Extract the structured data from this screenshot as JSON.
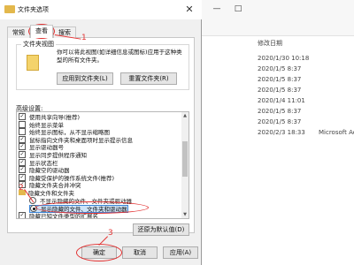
{
  "dialog": {
    "title": "文件夹选项",
    "close_glyph": "✕",
    "tabs": [
      "常规",
      "查看",
      "搜索"
    ],
    "folder_view": {
      "legend": "文件夹视图",
      "description": "你可以将此视图(如详细信息或图标)应用于这种类型的所有文件夹。",
      "apply_button": "应用到文件夹(L)",
      "reset_button": "重置文件夹(R)"
    },
    "advanced": {
      "label": "高级设置:",
      "items": [
        {
          "type": "checkbox",
          "checked": true,
          "label": "使用共享向导(推荐)"
        },
        {
          "type": "checkbox",
          "checked": false,
          "label": "始终显示菜单"
        },
        {
          "type": "checkbox",
          "checked": false,
          "label": "始终显示图标，从不显示缩略图"
        },
        {
          "type": "checkbox",
          "checked": true,
          "label": "鼠标指向文件夹和桌面项时显示提示信息"
        },
        {
          "type": "checkbox",
          "checked": true,
          "label": "显示驱动器号"
        },
        {
          "type": "checkbox",
          "checked": true,
          "label": "显示同步提供程序通知"
        },
        {
          "type": "checkbox",
          "checked": true,
          "label": "显示状态栏"
        },
        {
          "type": "checkbox",
          "checked": true,
          "label": "隐藏空的驱动器"
        },
        {
          "type": "checkbox",
          "checked": true,
          "label": "隐藏受保护的操作系统文件(推荐)"
        },
        {
          "type": "checkbox",
          "checked": true,
          "label": "隐藏文件夹合并冲突"
        },
        {
          "type": "folder",
          "label": "隐藏文件和文件夹"
        },
        {
          "type": "radio",
          "checked": false,
          "label": "不显示隐藏的文件、文件夹或驱动器"
        },
        {
          "type": "radio",
          "checked": true,
          "label": "显示隐藏的文件、文件夹和驱动器"
        },
        {
          "type": "checkbox",
          "checked": true,
          "label": "隐藏已知文件类型的扩展名"
        }
      ]
    },
    "restore_button": "还原为默认值(D)",
    "ok_button": "确定",
    "cancel_button": "取消",
    "apply_button": "应用(A)"
  },
  "explorer": {
    "date_header": "修改日期",
    "dates": [
      "2020/1/30 10:18",
      "2020/1/5 8:37",
      "2020/1/5 8:37",
      "2020/1/5 8:37",
      "2020/1/4 11:01",
      "2020/1/5 8:37",
      "2020/1/5 8:37",
      "2020/2/3 18:33"
    ],
    "types": [
      "",
      "",
      "",
      "",
      "",
      "",
      "",
      "Microsoft Acce"
    ],
    "window_buttons": [
      "—",
      "□"
    ]
  },
  "annotations": [
    "1",
    "2",
    "3"
  ],
  "colors": {
    "annotation": "#e33333",
    "selection": "#cde3f8",
    "selection_border": "#3b84d6"
  }
}
